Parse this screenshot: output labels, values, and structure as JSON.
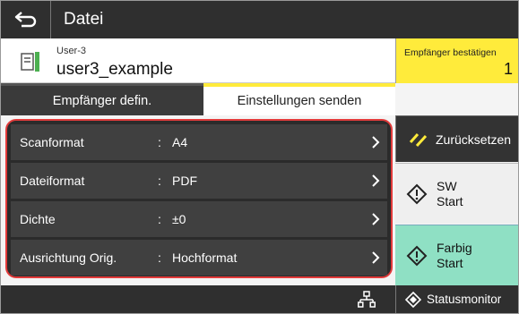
{
  "header": {
    "title": "Datei"
  },
  "recipient": {
    "sub_label": "User-3",
    "name": "user3_example"
  },
  "confirm": {
    "label": "Empfänger bestätigen",
    "count": "1"
  },
  "tabs": [
    {
      "label": "Empfänger defin.",
      "active": false
    },
    {
      "label": "Einstellungen senden",
      "active": true
    }
  ],
  "settings": [
    {
      "label": "Scanformat",
      "value": "A4"
    },
    {
      "label": "Dateiformat",
      "value": "PDF"
    },
    {
      "label": "Dichte",
      "value": "±0"
    },
    {
      "label": "Ausrichtung Orig.",
      "value": "Hochformat"
    }
  ],
  "separator": ":",
  "buttons": {
    "reset": "Zurücksetzen",
    "bw_start_line1": "SW",
    "bw_start_line2": "Start",
    "color_start_line1": "Farbig",
    "color_start_line2": "Start",
    "status_monitor": "Statusmonitor"
  },
  "colors": {
    "accent": "#ffeb3b",
    "highlight_border": "#e23b3b",
    "color_start_bg": "#8fe0c4"
  }
}
